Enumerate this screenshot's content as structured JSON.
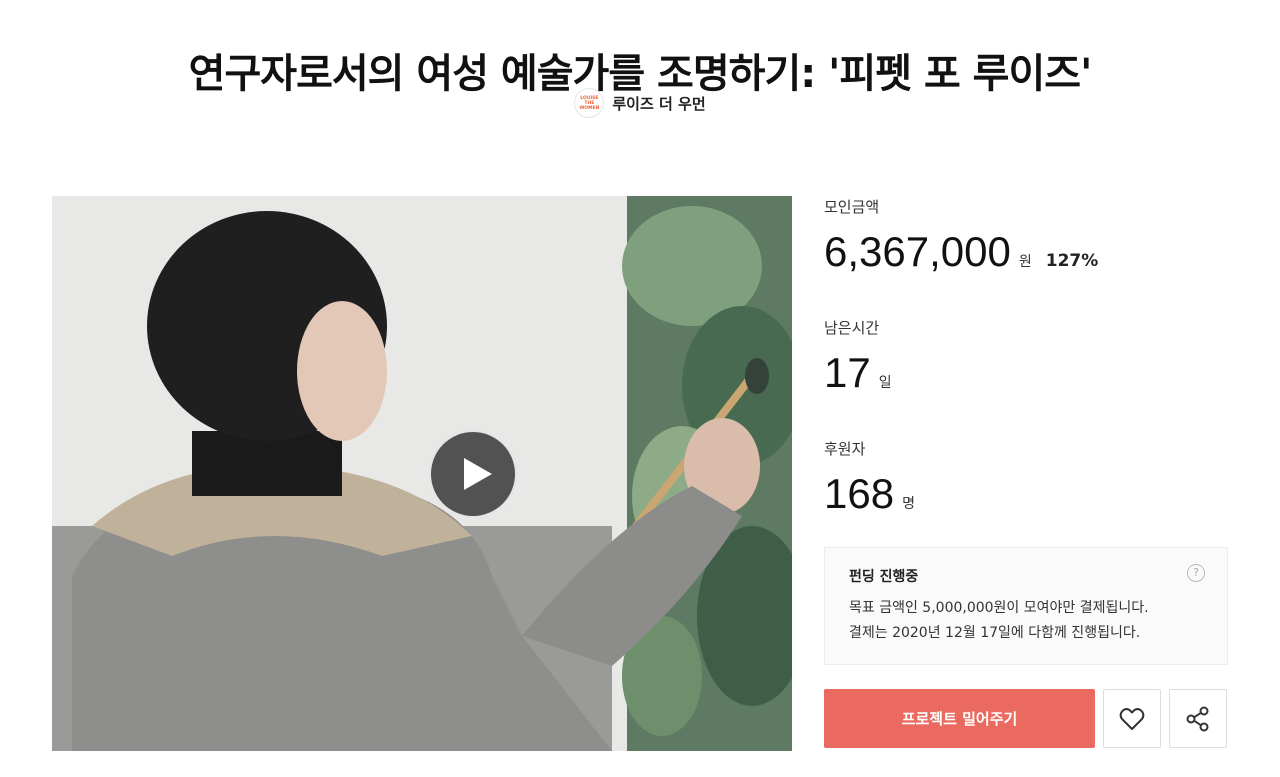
{
  "project": {
    "title": "연구자로서의 여성 예술가를 조명하기: '피펫 포 루이즈'"
  },
  "creator": {
    "logo_lines": [
      "LOUISE",
      "THE",
      "WOMEN"
    ],
    "name": "루이즈 더 우먼"
  },
  "stats": {
    "raised_label": "모인금액",
    "raised_value": "6,367,000",
    "raised_unit": "원",
    "raised_percent": "127%",
    "time_label": "남은시간",
    "time_value": "17",
    "time_unit": "일",
    "backers_label": "후원자",
    "backers_value": "168",
    "backers_unit": "명"
  },
  "notice": {
    "title": "펀딩 진행중",
    "line1": "목표 금액인 5,000,000원이 모여야만 결제됩니다.",
    "line2": "결제는 2020년 12월 17일에 다함께 진행됩니다.",
    "help_symbol": "?"
  },
  "actions": {
    "back_label": "프로젝트 밀어주기"
  },
  "colors": {
    "accent": "#ea6a5f",
    "logo": "#e8643c"
  },
  "icons": {
    "play": "play-icon",
    "like": "heart-icon",
    "share": "share-icon",
    "help": "help-icon"
  }
}
